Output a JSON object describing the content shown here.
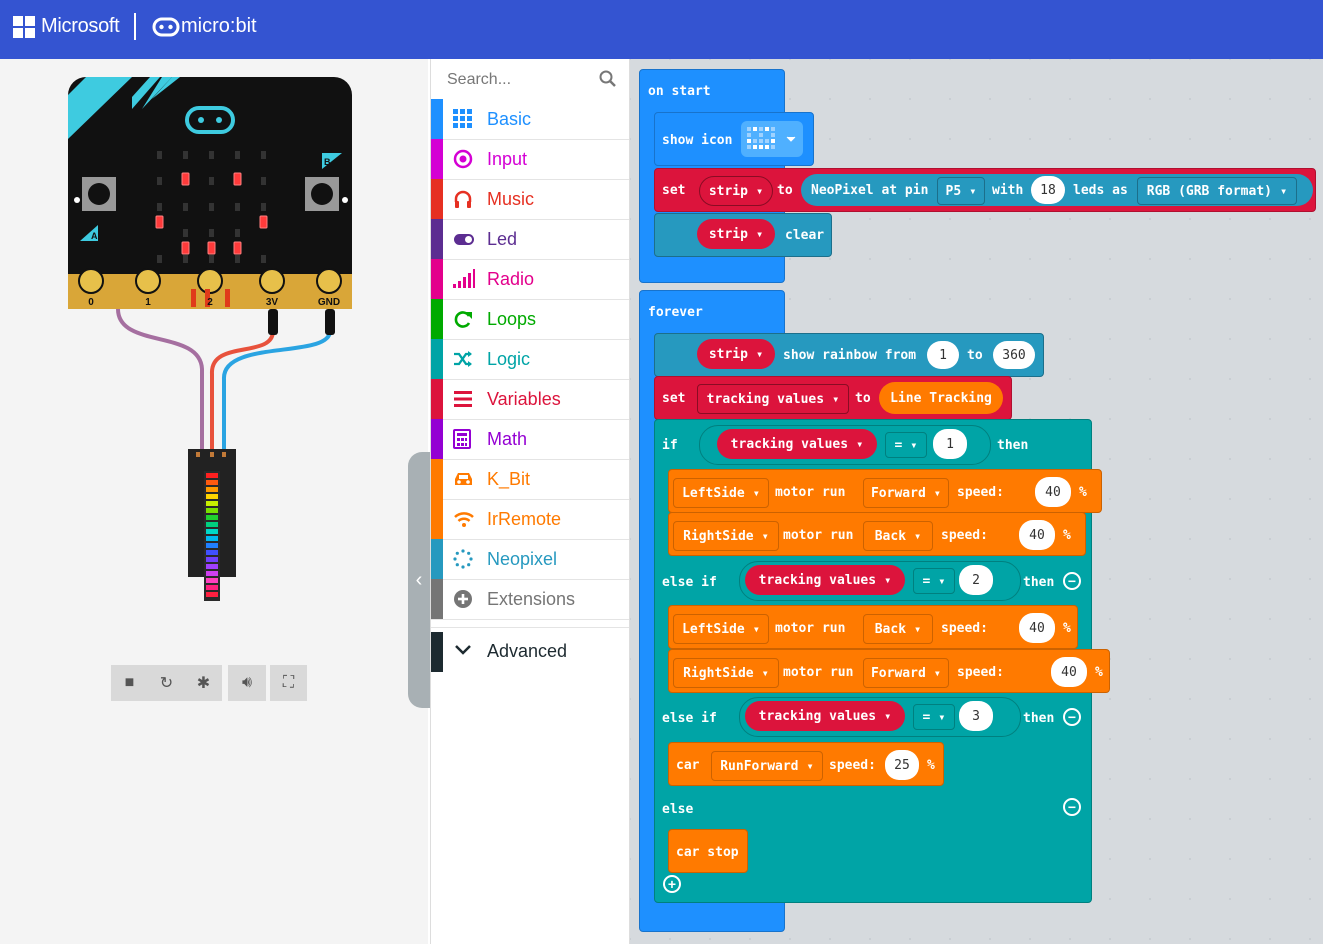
{
  "header": {
    "brand": "Microsoft",
    "product": "micro:bit"
  },
  "simulator": {
    "pin_labels": [
      "0",
      "1",
      "2",
      "3V",
      "GND"
    ],
    "button_a": "A",
    "button_b": "B"
  },
  "toolbox": {
    "search_placeholder": "Search...",
    "categories": [
      {
        "label": "Basic",
        "color": "#1e90ff",
        "icon": "grid-icon"
      },
      {
        "label": "Input",
        "color": "#d400d4",
        "icon": "target-icon"
      },
      {
        "label": "Music",
        "color": "#e63022",
        "icon": "headphones-icon"
      },
      {
        "label": "Led",
        "color": "#5c2d91",
        "icon": "toggle-icon"
      },
      {
        "label": "Radio",
        "color": "#e3008c",
        "icon": "signal-bars-icon"
      },
      {
        "label": "Loops",
        "color": "#00aa00",
        "icon": "loop-arrow-icon"
      },
      {
        "label": "Logic",
        "color": "#00a4a6",
        "icon": "shuffle-icon"
      },
      {
        "label": "Variables",
        "color": "#dc143c",
        "icon": "lines-icon"
      },
      {
        "label": "Math",
        "color": "#9400d3",
        "icon": "calculator-icon"
      },
      {
        "label": "K_Bit",
        "color": "#ff7a00",
        "icon": "car-icon"
      },
      {
        "label": "IrRemote",
        "color": "#ff7a00",
        "icon": "wifi-icon"
      },
      {
        "label": "Neopixel",
        "color": "#2699bf",
        "icon": "dotted-circle-icon"
      },
      {
        "label": "Extensions",
        "color": "#757575",
        "icon": "plus-circle-icon"
      }
    ],
    "advanced_label": "Advanced"
  },
  "blocks": {
    "on_start": "on start",
    "show_icon": "show icon",
    "set": "set",
    "strip": "strip",
    "to": "to",
    "neopixel_at_pin": "NeoPixel at pin",
    "pin": "P5",
    "with": "with",
    "led_count": "18",
    "leds_as": "leds as",
    "format": "RGB (GRB format)",
    "clear": "clear",
    "forever": "forever",
    "show_rainbow_from": "show rainbow from",
    "rainbow_from": "1",
    "rainbow_to": "360",
    "tracking_values": "tracking values",
    "line_tracking": "Line Tracking",
    "if": "if",
    "eq": "=",
    "then": "then",
    "else_if": "else if",
    "else": "else",
    "val1": "1",
    "val2": "2",
    "val3": "3",
    "left_side": "LeftSide",
    "right_side": "RightSide",
    "motor_run": "motor run",
    "forward": "Forward",
    "back": "Back",
    "speed": "speed:",
    "speed40": "40",
    "pct": "%",
    "car": "car",
    "run_forward": "RunForward",
    "speed25": "25",
    "car_stop": "car stop"
  }
}
